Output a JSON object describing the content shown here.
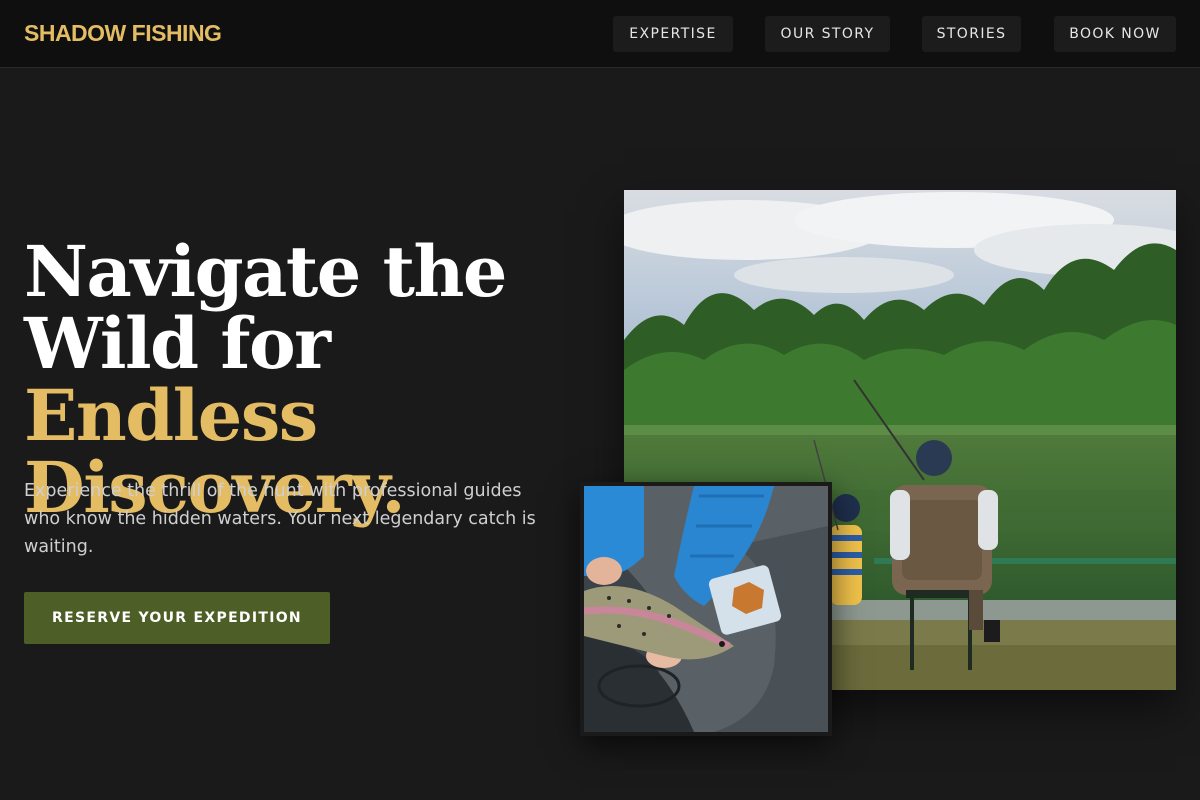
{
  "brand": {
    "name": "SHADOW FISHING"
  },
  "nav": {
    "items": [
      {
        "label": "EXPERTISE"
      },
      {
        "label": "OUR STORY"
      },
      {
        "label": "STORIES"
      },
      {
        "label": "BOOK NOW"
      }
    ]
  },
  "hero": {
    "headline_line1": "Navigate the",
    "headline_line2_white": "Wild for ",
    "headline_line2_accent": "Endless",
    "headline_line3_accent": "Discovery.",
    "subtext": "Experience the thrill of the hunt with professional guides who know the hidden waters. Your next legendary catch is waiting.",
    "cta_label": "RESERVE YOUR EXPEDITION"
  },
  "colors": {
    "background": "#1a1a1a",
    "header_background": "#0f0f0f",
    "accent_gold": "#e3bc63",
    "cta_green": "#4d5e26"
  }
}
